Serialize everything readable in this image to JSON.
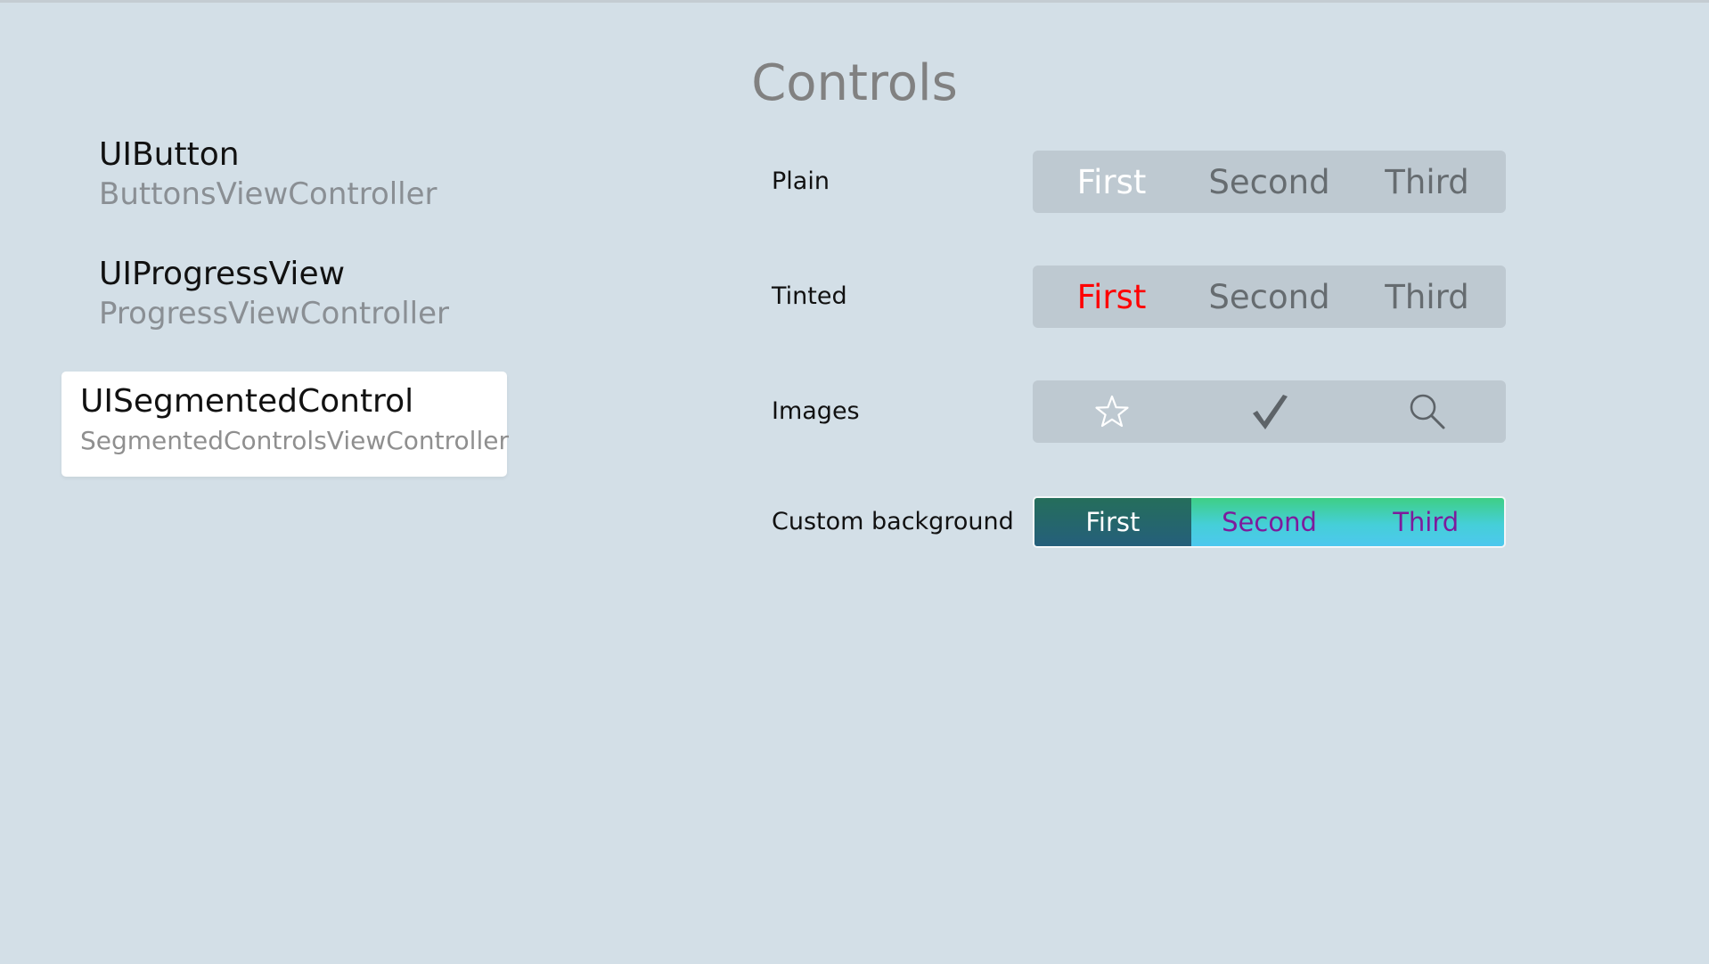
{
  "page": {
    "title": "Controls"
  },
  "sidebar": {
    "items": [
      {
        "title": "UIButton",
        "subtitle": "ButtonsViewController",
        "selected": false
      },
      {
        "title": "UIProgressView",
        "subtitle": "ProgressViewController",
        "selected": false
      },
      {
        "title": "UISegmentedControl",
        "subtitle": "SegmentedControlsViewController",
        "selected": true
      }
    ]
  },
  "rows": {
    "plain": {
      "label": "Plain",
      "segments": [
        "First",
        "Second",
        "Third"
      ],
      "selected_index": 0
    },
    "tinted": {
      "label": "Tinted",
      "segments": [
        "First",
        "Second",
        "Third"
      ],
      "selected_index": 0,
      "tint_color": "#ff0000"
    },
    "images": {
      "label": "Images",
      "segments": [
        "star-icon",
        "checkmark-icon",
        "search-icon"
      ],
      "selected_index": 1
    },
    "custom": {
      "label": "Custom background",
      "segments": [
        "First",
        "Second",
        "Third"
      ],
      "selected_index": 0,
      "text_color": "#7d1b9c",
      "selected_color": "#256e5b"
    }
  },
  "colors": {
    "background": "#d3dfe7",
    "segment_background": "#bec9d1",
    "title": "#818181"
  }
}
